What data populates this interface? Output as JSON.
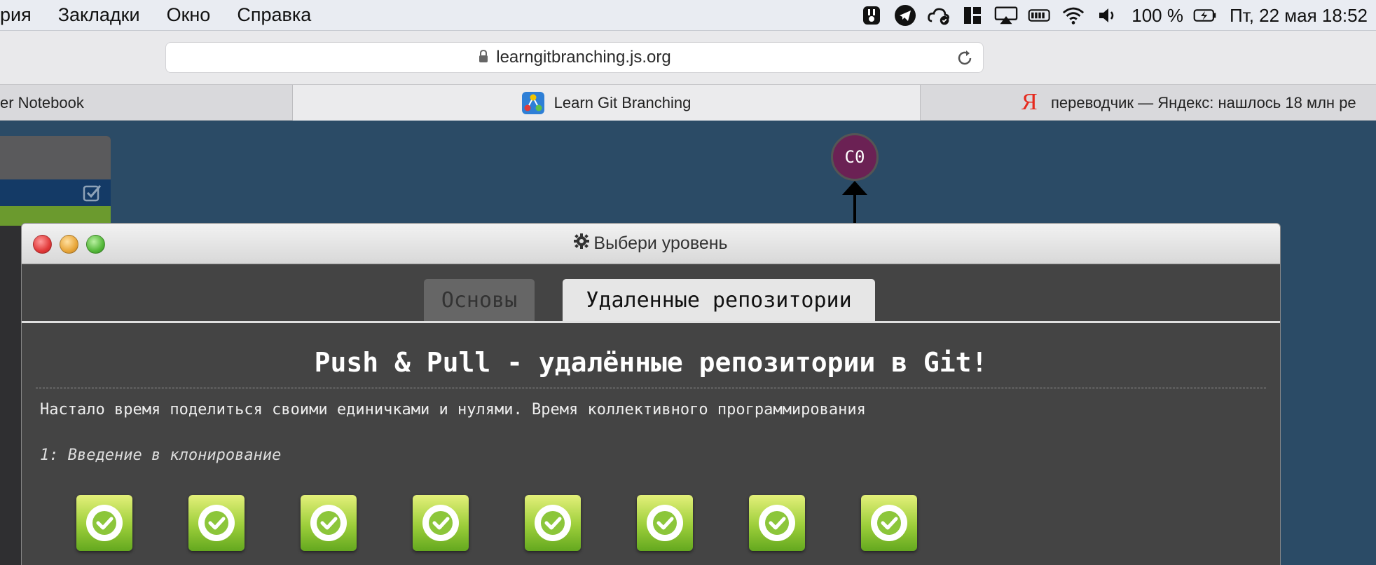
{
  "menubar": {
    "items": [
      "рия",
      "Закладки",
      "Окно",
      "Справка"
    ],
    "status": {
      "icons": [
        "hook-icon",
        "telegram-icon",
        "cloud-sync-icon",
        "window-layout-icon",
        "airplay-icon",
        "battery-indicator-icon",
        "wifi-icon",
        "volume-icon"
      ],
      "battery_percent": "100 %",
      "datetime": "Пт, 22 мая  18:52"
    }
  },
  "toolbar": {
    "url": "learngitbranching.js.org"
  },
  "tabs": [
    {
      "label": "er Notebook"
    },
    {
      "label": "Learn Git Branching"
    },
    {
      "label": "переводчик — Яндекс: нашлось 18 млн ре"
    }
  ],
  "yandex_mark": "Я",
  "graph": {
    "node_label": "C0"
  },
  "modal": {
    "title": "Выбери уровень",
    "tabs": [
      "Основы",
      "Удаленные репозитории"
    ],
    "section_title": "Push & Pull - удалённые репозитории в Git!",
    "section_desc": "Настало время поделиться своими единичками и нулями. Время коллективного программирования",
    "sequence_name": "1: Введение в клонирование",
    "level_count": 8,
    "level_status": "completed",
    "colors": {
      "accent_green": "#9cce3a",
      "node_fill": "#6b2154",
      "page_bg": "#2b4b66"
    }
  }
}
